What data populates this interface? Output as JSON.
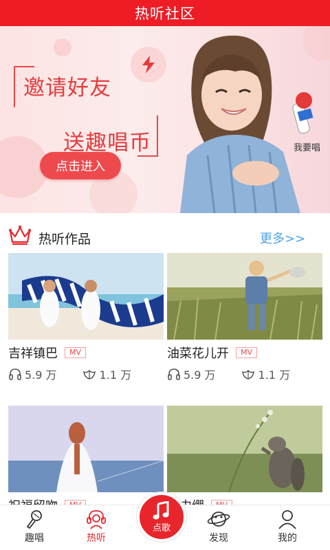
{
  "header": {
    "title": "热听社区"
  },
  "banner": {
    "line1": "邀请好友",
    "line2": "送趣唱币",
    "button": "点击进入",
    "mic_label": "我要唱"
  },
  "section": {
    "title": "热听作品",
    "more": "更多>>"
  },
  "cards": [
    {
      "name": "吉祥镇巴",
      "tag": "MV",
      "plays": "5.9 万",
      "likes": "1.1 万"
    },
    {
      "name": "油菜花儿开",
      "tag": "MV",
      "plays": "5.9 万",
      "likes": "1.1 万"
    },
    {
      "name": "祝福留吻",
      "tag": "MV",
      "plays": "",
      "likes": ""
    },
    {
      "name": "马中绷",
      "tag": "MV",
      "plays": "",
      "likes": ""
    }
  ],
  "nav": {
    "items": [
      {
        "label": "趣唱",
        "icon": "microphone-icon"
      },
      {
        "label": "热听",
        "icon": "headphone-person-icon"
      },
      {
        "label": "点歌",
        "icon": "music-note-icon"
      },
      {
        "label": "发现",
        "icon": "planet-icon"
      },
      {
        "label": "我的",
        "icon": "user-icon"
      }
    ],
    "active": "热听"
  },
  "colors": {
    "accent": "#ee1c25",
    "link": "#4ea2e8"
  }
}
